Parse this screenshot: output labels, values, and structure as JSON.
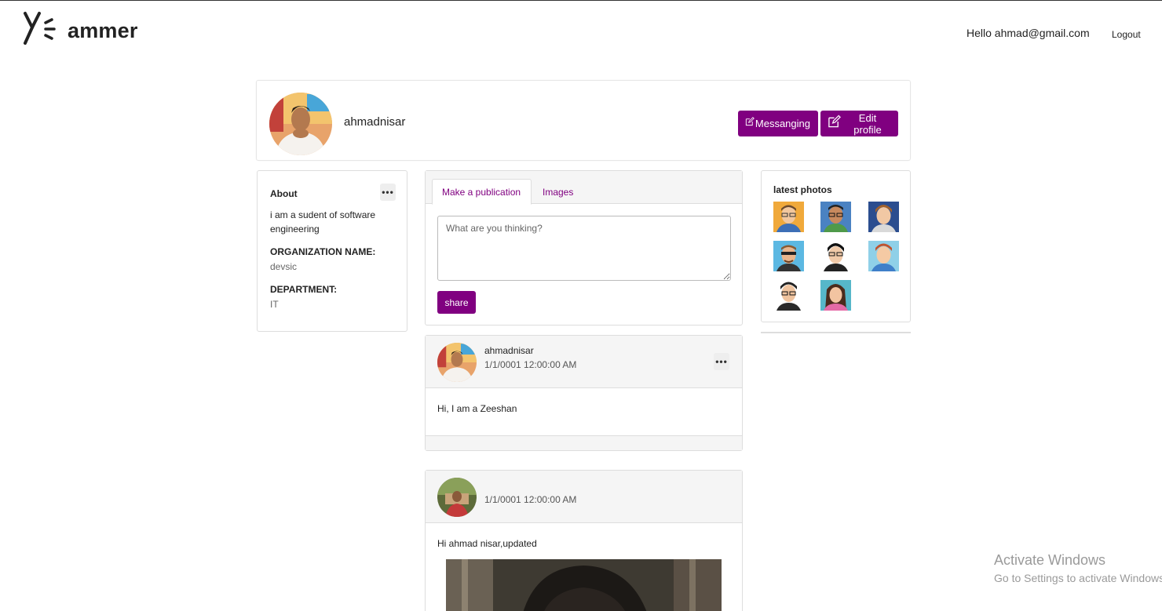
{
  "header": {
    "logo_text": "ammer",
    "greeting": "Hello ahmad@gmail.com",
    "logout_label": "Logout"
  },
  "profile": {
    "name": "ahmadnisar",
    "messaging_label": "Messanging",
    "edit_label": "Edit profile"
  },
  "about": {
    "title": "About",
    "description": "i am a sudent of software engineering",
    "organization_label": "ORGANIZATION NAME:",
    "organization_value": "devsic",
    "department_label": "DEPARTMENT:",
    "department_value": "IT"
  },
  "composer": {
    "tabs": [
      {
        "label": "Make a publication"
      },
      {
        "label": "Images"
      }
    ],
    "placeholder": "What are you thinking?",
    "share_label": "share"
  },
  "latest_photos": {
    "title": "latest photos"
  },
  "posts": [
    {
      "author": "ahmadnisar",
      "date": "1/1/0001 12:00:00 AM",
      "body": "Hi, I am a Zeeshan"
    },
    {
      "author": "",
      "date": "1/1/0001 12:00:00 AM",
      "body": "Hi ahmad nisar,updated"
    }
  ],
  "watermark": {
    "line1": "Activate Windows",
    "line2": "Go to Settings to activate Windows."
  },
  "colors": {
    "accent": "#800080",
    "panel_bg": "#f5f5f5",
    "border": "#dddddd"
  },
  "icons": [
    "edit-icon",
    "more-options-icon"
  ]
}
